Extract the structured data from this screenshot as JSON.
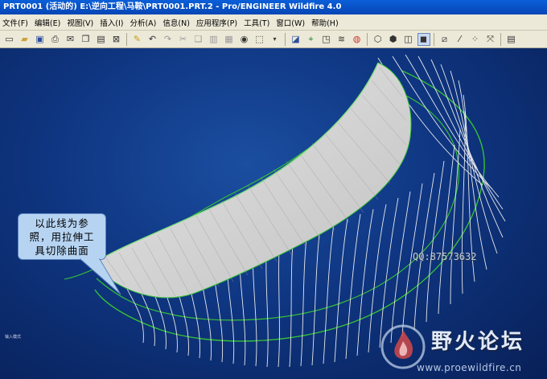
{
  "window": {
    "title": "PRT0001 (活动的) E:\\逆向工程\\马鞍\\PRT0001.PRT.2 - Pro/ENGINEER Wildfire 4.0"
  },
  "menu": {
    "items": [
      {
        "label": "文件(F)"
      },
      {
        "label": "编辑(E)"
      },
      {
        "label": "视图(V)"
      },
      {
        "label": "插入(I)"
      },
      {
        "label": "分析(A)"
      },
      {
        "label": "信息(N)"
      },
      {
        "label": "应用程序(P)"
      },
      {
        "label": "工具(T)"
      },
      {
        "label": "窗口(W)"
      },
      {
        "label": "帮助(H)"
      }
    ]
  },
  "toolbar": {
    "icons": [
      "new-icon",
      "open-icon",
      "save-icon",
      "print-icon",
      "send-icon",
      "copy-icon",
      "paste-icon",
      "close-icon",
      "regenerate-icon",
      "undo-icon",
      "redo-icon",
      "cut-icon",
      "copy2-icon",
      "paste2-icon",
      "paste-special-icon",
      "find-icon",
      "select-box-icon",
      "dropdown-icon",
      "model-tree-icon",
      "display-icon",
      "datum-icon",
      "layers-icon",
      "appearance-icon",
      "wireframe-icon",
      "hidden-line-icon",
      "no-hidden-icon",
      "shading-icon",
      "plane-display-icon",
      "axis-display-icon",
      "point-display-icon",
      "csys-display-icon",
      "save-view-icon"
    ]
  },
  "viewport": {
    "callout_lines": [
      "以此线为参",
      "照，用拉伸工",
      "具切除曲面"
    ],
    "qq_label": "QQ:87573632",
    "status_text": "输入模式"
  },
  "watermark": {
    "title": "野火论坛",
    "url": "www.proewildfire.cn"
  },
  "colors": {
    "background": "#0f3682",
    "surface": "#d8d8d8",
    "curve_green": "#35c035",
    "curve_white": "#ffffff",
    "callout": "#b6d4f2"
  }
}
